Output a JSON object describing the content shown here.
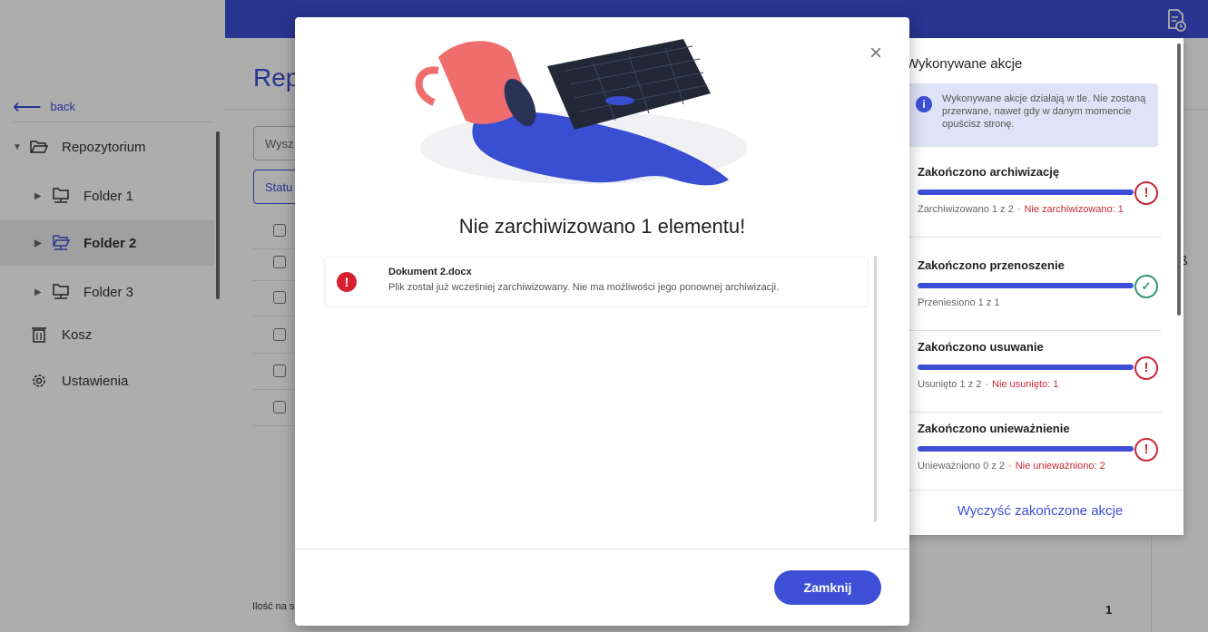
{
  "sidebar": {
    "back_label": "back",
    "items": [
      {
        "label": "Repozytorium"
      },
      {
        "label": "Folder 1"
      },
      {
        "label": "Folder 2"
      },
      {
        "label": "Folder 3"
      },
      {
        "label": "Kosz"
      },
      {
        "label": "Ustawienia"
      }
    ]
  },
  "main": {
    "title": "Rep",
    "search_placeholder": "Wysz",
    "status_filter": "Statu",
    "footer_label": "Ilość na s",
    "page_number": "1",
    "right_chars": [
      ")",
      "›",
      "ß"
    ]
  },
  "actions_panel": {
    "title": "Wykonywane akcje",
    "info": "Wykonywane akcje działają w tle. Nie zostaną przerwane, nawet gdy w danym momencie opuścisz stronę.",
    "cards": [
      {
        "title": "Zakończono archiwizację",
        "progress": 1.0,
        "status": "error",
        "done": "Zarchiwizowano 1 z 2",
        "failed": "Nie zarchiwizowano: 1"
      },
      {
        "title": "Zakończono przenoszenie",
        "progress": 1.0,
        "status": "success",
        "done": "Przeniesiono 1 z 1",
        "failed": ""
      },
      {
        "title": "Zakończono usuwanie",
        "progress": 1.0,
        "status": "error",
        "done": "Usunięto 1 z 2",
        "failed": "Nie usunięto: 1"
      },
      {
        "title": "Zakończono unieważnienie",
        "progress": 1.0,
        "status": "error",
        "done": "Unieważniono 0 z 2",
        "failed": "Nie unieważniono: 2"
      }
    ],
    "clear_label": "Wyczyść zakończone akcje"
  },
  "modal": {
    "title": "Nie zarchiwizowano 1 elementu!",
    "errors": [
      {
        "name": "Dokument 2.docx",
        "message": "Plik został już wcześniej zarchiwizowany. Nie ma możliwości jego ponownej archiwizacji."
      }
    ],
    "close_button": "Zamknij"
  },
  "colors": {
    "accent": "#3c4fd6",
    "error": "#c62835",
    "success": "#2f9a6b"
  }
}
